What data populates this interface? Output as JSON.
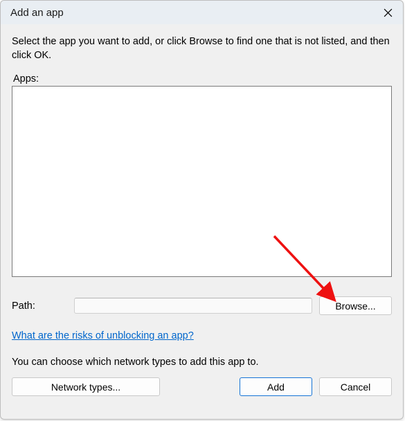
{
  "title": "Add an app",
  "instruction": "Select the app you want to add, or click Browse to find one that is not listed, and then click OK.",
  "apps_label": "Apps:",
  "apps_items": [],
  "path_label": "Path:",
  "path_value": "",
  "browse_label": "Browse...",
  "risks_link": "What are the risks of unblocking an app?",
  "network_text": "You can choose which network types to add this app to.",
  "network_types_label": "Network types...",
  "add_label": "Add",
  "cancel_label": "Cancel"
}
